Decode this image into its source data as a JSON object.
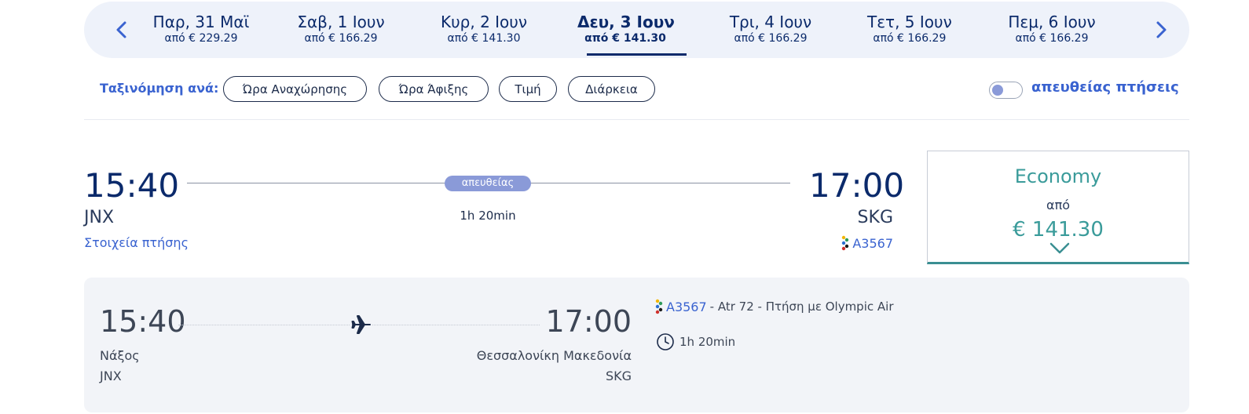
{
  "date_bar": {
    "dates": [
      {
        "label": "Παρ, 31 Μαϊ",
        "price": "από € 229.29"
      },
      {
        "label": "Σαβ, 1 Ιουν",
        "price": "από € 166.29"
      },
      {
        "label": "Κυρ, 2 Ιουν",
        "price": "από € 141.30"
      },
      {
        "label": "Δευ, 3 Ιουν",
        "price": "από € 141.30",
        "active": true
      },
      {
        "label": "Τρι, 4 Ιουν",
        "price": "από € 166.29"
      },
      {
        "label": "Τετ, 5 Ιουν",
        "price": "από € 166.29"
      },
      {
        "label": "Πεμ, 6 Ιουν",
        "price": "από € 166.29"
      }
    ]
  },
  "sort": {
    "label": "Ταξινόμηση ανά:",
    "options": [
      "Ώρα Αναχώρησης",
      "Ώρα Άφιξης",
      "Τιμή",
      "Διάρκεια"
    ]
  },
  "filter": {
    "direct_label": "απευθείας πτήσεις",
    "direct_only": false
  },
  "flight": {
    "departure_time": "15:40",
    "departure_code": "JNX",
    "details_link": "Στοιχεία πτήσης",
    "stops_badge": "απευθείας",
    "duration": "1h 20min",
    "arrival_time": "17:00",
    "arrival_code": "SKG",
    "flight_number": "A3567"
  },
  "fare": {
    "class": "Economy",
    "from_label": "από",
    "price": "€ 141.30"
  },
  "details": {
    "departure_time": "15:40",
    "arrival_time": "17:00",
    "departure_city": "Νάξος",
    "departure_code": "JNX",
    "arrival_city": "Θεσσαλονίκη Μακεδονία",
    "arrival_code": "SKG",
    "flight_number": "A3567",
    "flight_info": " - Atr 72 - Πτήση με Olympic Air",
    "duration": "1h 20min"
  },
  "colors": {
    "primary_navy": "#0b2a6b",
    "link_blue": "#3a63d0",
    "teal": "#3a9b9a",
    "badge": "#8a9ad8"
  }
}
